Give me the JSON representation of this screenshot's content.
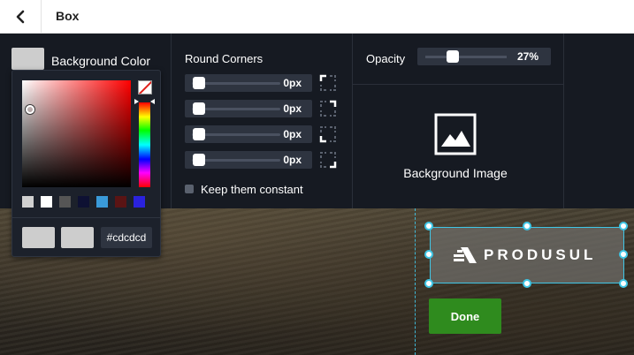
{
  "topbar": {
    "title": "Box",
    "back_icon": "chevron-left-icon"
  },
  "background_color": {
    "label": "Background Color",
    "value": "#cdcdcd"
  },
  "color_picker": {
    "hex": "#cdcdcd",
    "presets": [
      "#d0d0d0",
      "#ffffff",
      "#555555",
      "#0e1133",
      "#3a9ad9",
      "#5a1414",
      "#2a22dd"
    ],
    "recent": [
      "#cdcdcd",
      "#cdcdcd"
    ]
  },
  "round_corners": {
    "title": "Round Corners",
    "sliders": [
      {
        "value": "0px"
      },
      {
        "value": "0px"
      },
      {
        "value": "0px"
      },
      {
        "value": "0px"
      }
    ],
    "keep_constant_label": "Keep them constant"
  },
  "opacity": {
    "label": "Opacity",
    "value": "27%",
    "fraction": 0.27
  },
  "background_image": {
    "label": "Background Image",
    "icon": "image-icon"
  },
  "canvas": {
    "logo_text": "PRODUSUL",
    "done_label": "Done",
    "accent": "#3fc6e6",
    "done_color": "#2f8b1e"
  }
}
